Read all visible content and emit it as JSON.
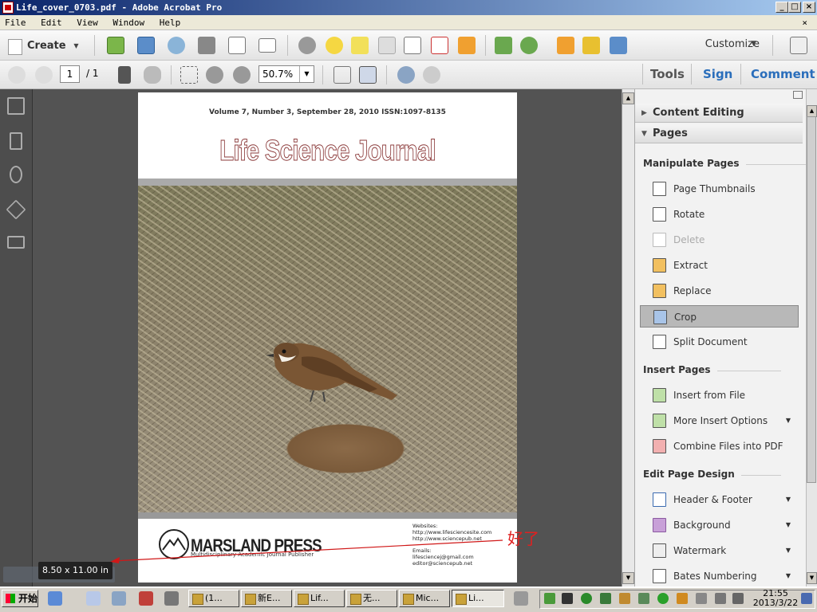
{
  "window": {
    "title": "Life_cover_0703.pdf - Adobe Acrobat Pro",
    "minimize": "_",
    "maximize": "□",
    "close": "×"
  },
  "menubar": {
    "items": [
      "File",
      "Edit",
      "View",
      "Window",
      "Help"
    ],
    "close": "×"
  },
  "toolbar": {
    "create_label": "Create",
    "customize_label": "Customize",
    "page_current": "1",
    "page_total": "/ 1",
    "zoom": "50.7%",
    "tools_label": "Tools",
    "sign_label": "Sign",
    "comment_label": "Comment",
    "accent": "#2a6ebb"
  },
  "document": {
    "volume_line": "Volume 7, Number 3,   September 28, 2010   ISSN:1097-8135",
    "journal_title": "Life Science Journal",
    "publisher": "MARSLAND PRESS",
    "publisher_sub": "Multidisciplinary Academic Journal Publisher",
    "websites_label": "Websites:",
    "website1": "http://www.lifesciencesite.com",
    "website2": "http://www.sciencepub.net",
    "emails_label": "Emails:",
    "email1": "lifesciencej@gmail.com",
    "email2": "editor@sciencepub.net"
  },
  "annotation": {
    "chinese_text": "好了",
    "size_badge": "8.50 x 11.00 in"
  },
  "panel": {
    "content_editing": "Content Editing",
    "pages": "Pages",
    "manipulate_header": "Manipulate Pages",
    "manipulate_items": [
      {
        "label": "Page Thumbnails",
        "icon": "page-thumbnails-icon"
      },
      {
        "label": "Rotate",
        "icon": "rotate-icon"
      },
      {
        "label": "Delete",
        "icon": "delete-icon"
      },
      {
        "label": "Extract",
        "icon": "extract-icon"
      },
      {
        "label": "Replace",
        "icon": "replace-icon"
      },
      {
        "label": "Crop",
        "icon": "crop-icon"
      },
      {
        "label": "Split Document",
        "icon": "split-document-icon"
      }
    ],
    "insert_header": "Insert Pages",
    "insert_items": [
      {
        "label": "Insert from File",
        "icon": "insert-from-file-icon"
      },
      {
        "label": "More Insert Options",
        "icon": "more-insert-options-icon"
      },
      {
        "label": "Combine Files into PDF",
        "icon": "combine-files-icon"
      }
    ],
    "design_header": "Edit Page Design",
    "design_items": [
      {
        "label": "Header & Footer",
        "icon": "header-footer-icon"
      },
      {
        "label": "Background",
        "icon": "background-icon"
      },
      {
        "label": "Watermark",
        "icon": "watermark-icon"
      },
      {
        "label": "Bates Numbering",
        "icon": "bates-numbering-icon"
      }
    ]
  },
  "taskbar": {
    "start": "开始",
    "tasks": [
      "(1...",
      "新E...",
      "Lif...",
      "无...",
      "Mic...",
      "Li..."
    ],
    "time": "21:55",
    "date": "2013/3/22"
  }
}
